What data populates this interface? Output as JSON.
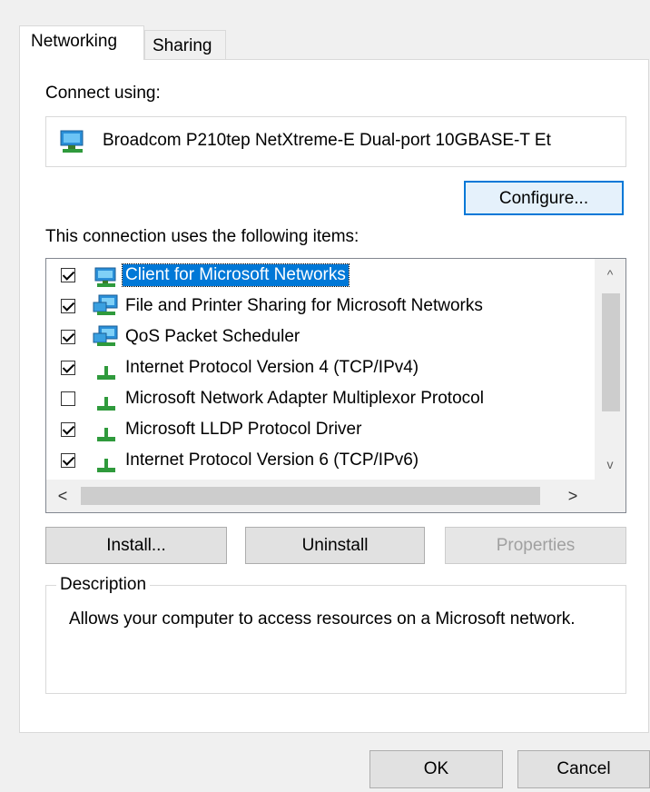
{
  "tabs": [
    {
      "label": "Networking",
      "active": true
    },
    {
      "label": "Sharing",
      "active": false
    }
  ],
  "connect_using_label": "Connect using:",
  "adapter": {
    "name": "Broadcom P210tep NetXtreme-E Dual-port 10GBASE-T Et",
    "icon": "network-adapter-icon"
  },
  "configure_label": "Configure...",
  "items_label": "This connection uses the following items:",
  "items": [
    {
      "label": "Client for Microsoft Networks",
      "checked": true,
      "selected": true,
      "icon": "network-client-icon"
    },
    {
      "label": "File and Printer Sharing for Microsoft Networks",
      "checked": true,
      "selected": false,
      "icon": "network-service-icon"
    },
    {
      "label": "QoS Packet Scheduler",
      "checked": true,
      "selected": false,
      "icon": "network-service-icon"
    },
    {
      "label": "Internet Protocol Version 4 (TCP/IPv4)",
      "checked": true,
      "selected": false,
      "icon": "protocol-icon"
    },
    {
      "label": "Microsoft Network Adapter Multiplexor Protocol",
      "checked": false,
      "selected": false,
      "icon": "protocol-icon"
    },
    {
      "label": "Microsoft LLDP Protocol Driver",
      "checked": true,
      "selected": false,
      "icon": "protocol-icon"
    },
    {
      "label": "Internet Protocol Version 6 (TCP/IPv6)",
      "checked": true,
      "selected": false,
      "icon": "protocol-icon"
    }
  ],
  "scroll": {
    "up": "^",
    "down": "v",
    "left": "<",
    "right": ">"
  },
  "buttons": {
    "install": "Install...",
    "uninstall": "Uninstall",
    "properties": "Properties",
    "ok": "OK",
    "cancel": "Cancel"
  },
  "description": {
    "legend": "Description",
    "text": "Allows your computer to access resources on a Microsoft network."
  },
  "colors": {
    "selection": "#0078d7",
    "focus_border": "#0078d7"
  }
}
